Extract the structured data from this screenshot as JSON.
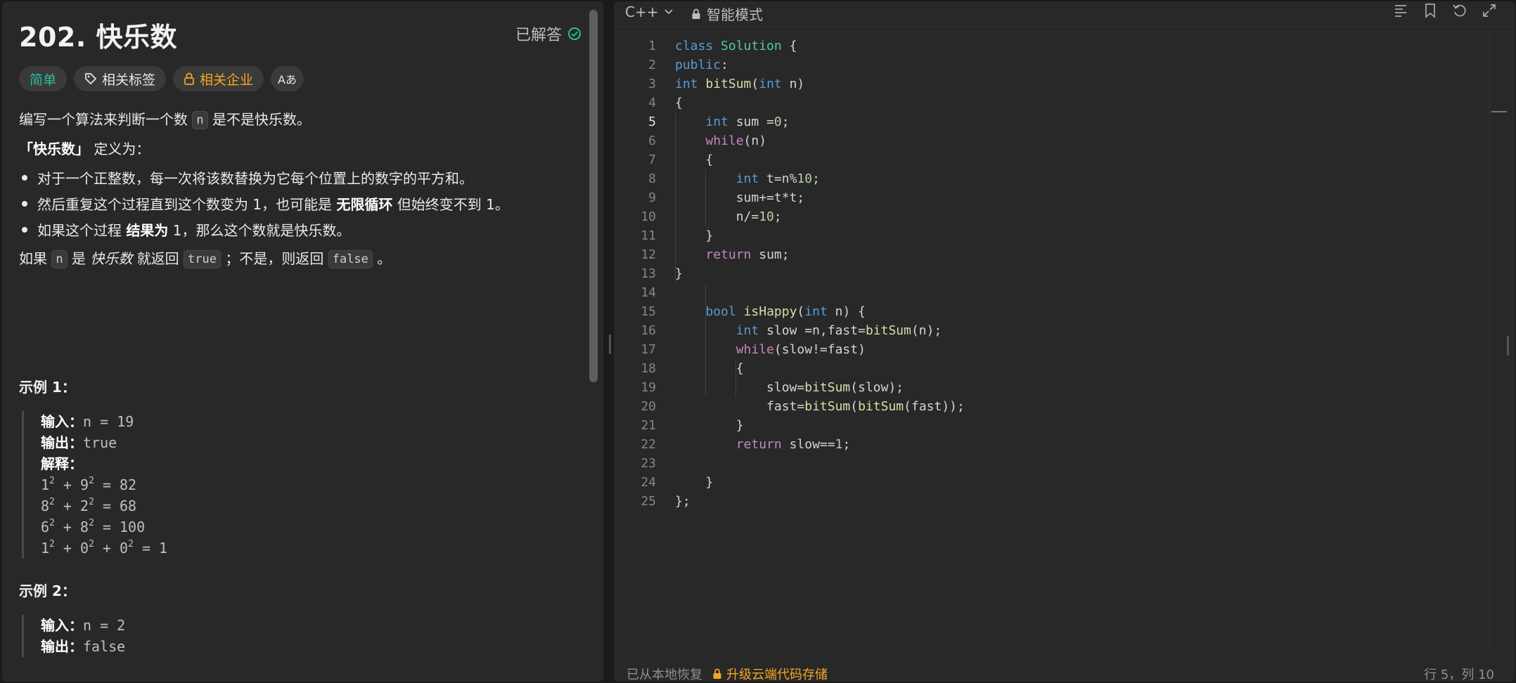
{
  "problem": {
    "title": "202. 快乐数",
    "solved_label": "已解答",
    "tags": {
      "difficulty": "简单",
      "topics": "相关标签",
      "companies": "相关企业",
      "font_icon": "Aあ"
    },
    "desc1_pre": "编写一个算法来判断一个数",
    "desc1_code": "n",
    "desc1_post": "是不是快乐数。",
    "def_bold": "「快乐数」",
    "def_rest": "定义为：",
    "bullet1": "对于一个正整数，每一次将该数替换为它每个位置上的数字的平方和。",
    "bullet2_pre": "然后重复这个过程直到这个数变为 1，也可能是",
    "bullet2_bold": "无限循环",
    "bullet2_post": "但始终变不到 1。",
    "bullet3_pre": "如果这个过程",
    "bullet3_bold": "结果为",
    "bullet3_post": "1，那么这个数就是快乐数。",
    "ret_a": "如果",
    "ret_n": "n",
    "ret_b": "是",
    "ret_italic": "快乐数",
    "ret_c": "就返回",
    "ret_true": "true",
    "ret_d": "；不是，则返回",
    "ret_false": "false",
    "ret_e": "。",
    "example1": {
      "title": "示例 1：",
      "input_label": "输入：",
      "input_value": "n = 19",
      "output_label": "输出：",
      "output_value": "true",
      "explain_label": "解释：",
      "lines": [
        [
          "1",
          "2",
          "+",
          "9",
          "2",
          "= 82"
        ],
        [
          "8",
          "2",
          "+",
          "2",
          "2",
          "= 68"
        ],
        [
          "6",
          "2",
          "+",
          "8",
          "2",
          "= 100"
        ]
      ],
      "line4": [
        "1",
        "2",
        "+",
        "0",
        "2",
        "+",
        "0",
        "2",
        "= 1"
      ]
    },
    "example2": {
      "title": "示例 2：",
      "input_label": "输入：",
      "input_value": "n = 2",
      "output_label": "输出：",
      "output_value": "false"
    }
  },
  "editor": {
    "language": "C++",
    "mode": "智能模式",
    "line_numbers": [
      "1",
      "2",
      "3",
      "4",
      "5",
      "6",
      "7",
      "8",
      "9",
      "10",
      "11",
      "12",
      "13",
      "14",
      "15",
      "16",
      "17",
      "18",
      "19",
      "20",
      "21",
      "22",
      "23",
      "24",
      "25"
    ],
    "restore_text": "已从本地恢复",
    "upgrade_text": "升级云端代码存储",
    "cursor_position": "行 5，列 10"
  },
  "colors": {
    "accent_orange": "#f5a623",
    "easy_green": "#2cbb9c",
    "keyword_blue": "#569cd6",
    "control_purple": "#c586c0",
    "function_yellow": "#dcdcaa",
    "class_teal": "#4ec9b0"
  },
  "icons": [
    "check-circle-icon",
    "tag-icon",
    "lock-icon",
    "font-size-icon",
    "chevron-down-icon",
    "list-icon",
    "bookmark-icon",
    "undo-icon",
    "fullscreen-icon"
  ]
}
